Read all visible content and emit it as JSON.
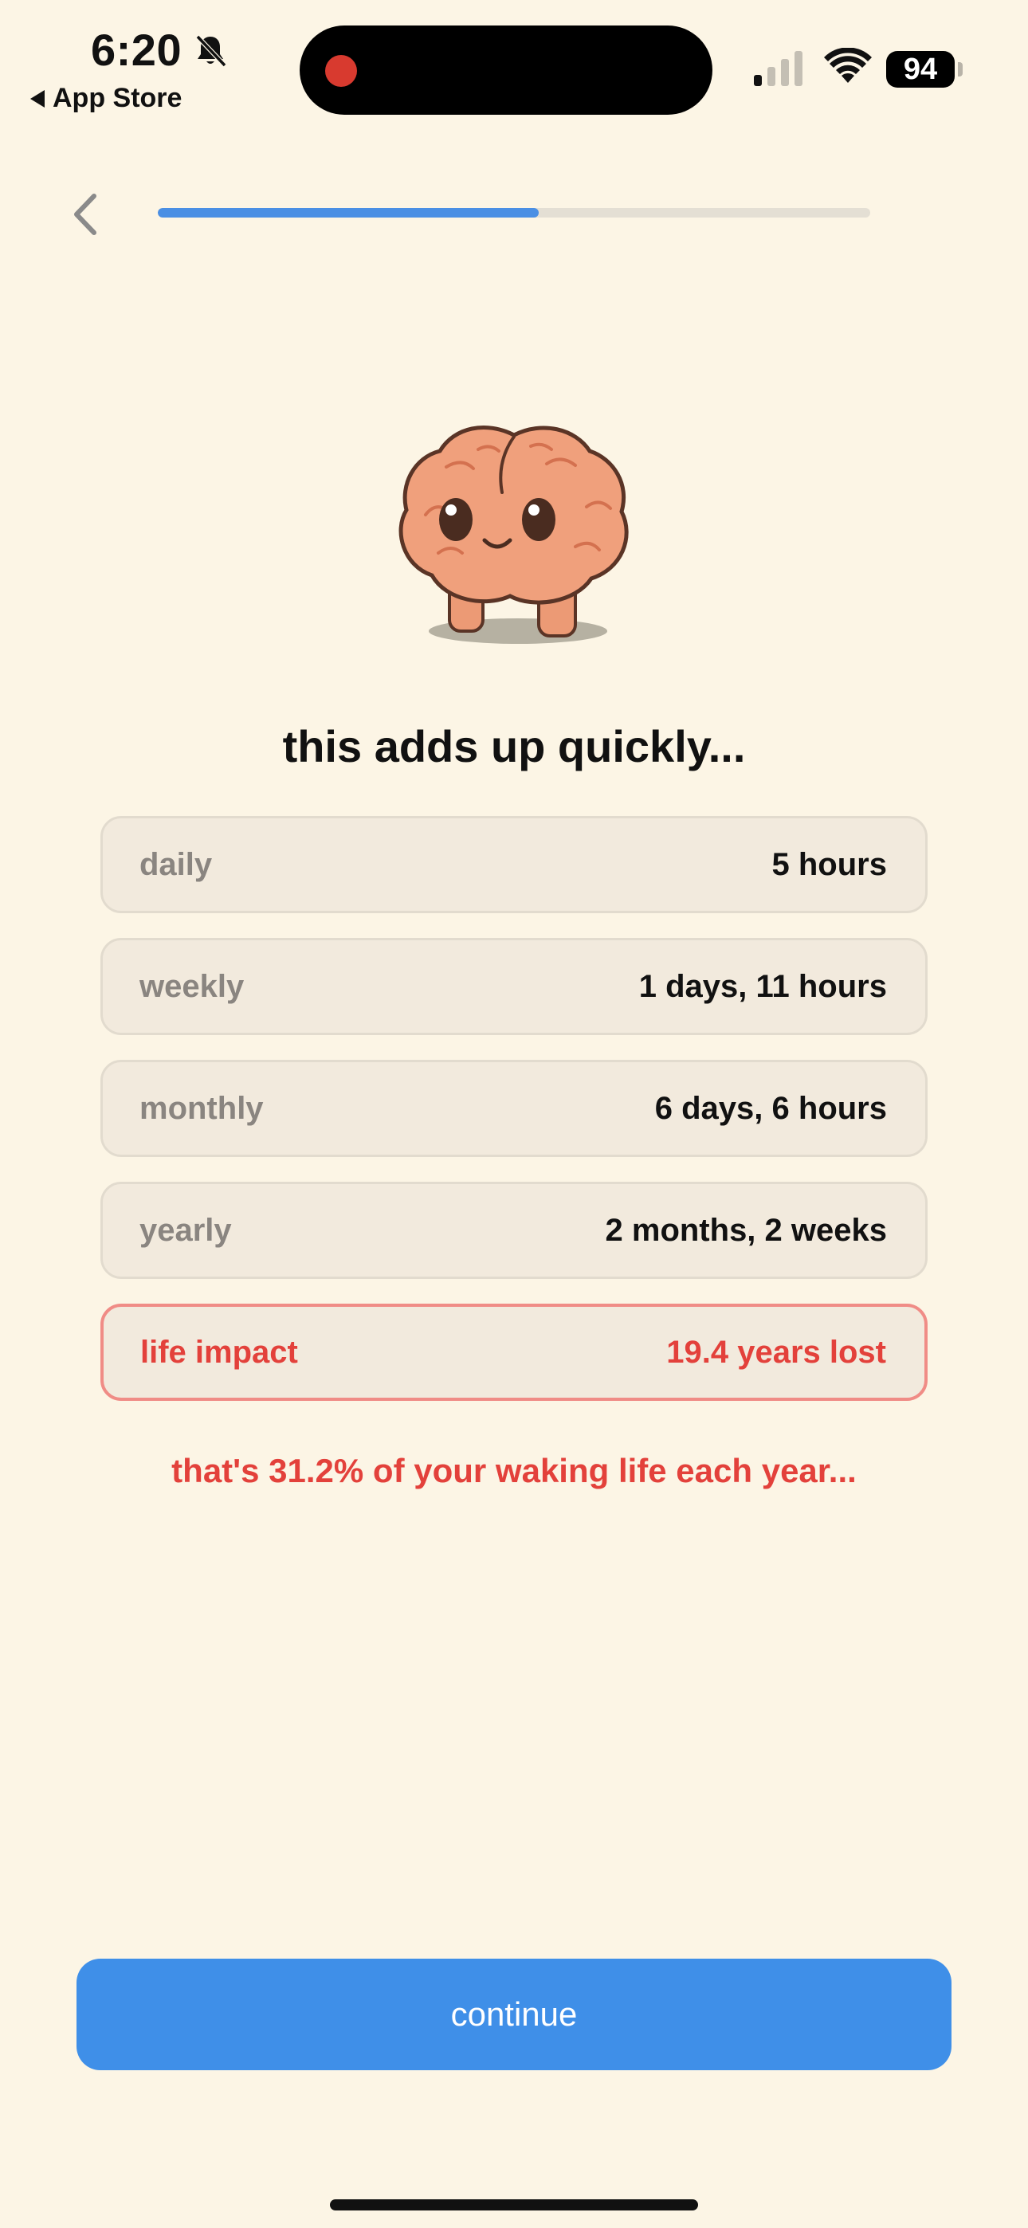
{
  "status_bar": {
    "time": "6:20",
    "back_app_label": "App Store",
    "battery_level": "94"
  },
  "progress": {
    "fraction": 0.535
  },
  "headline": "this adds up quickly...",
  "stats": [
    {
      "label": "daily",
      "value": "5 hours"
    },
    {
      "label": "weekly",
      "value": "1 days, 11 hours"
    },
    {
      "label": "monthly",
      "value": "6 days, 6 hours"
    },
    {
      "label": "yearly",
      "value": "2 months, 2 weeks"
    }
  ],
  "life_impact": {
    "label": "life impact",
    "value": "19.4 years lost"
  },
  "warning": "that's 31.2% of your waking life each year...",
  "continue_label": "continue",
  "colors": {
    "background": "#fcf5e5",
    "accent": "#3f8fe8",
    "danger": "#e3413b",
    "card": "#f2eadd"
  }
}
